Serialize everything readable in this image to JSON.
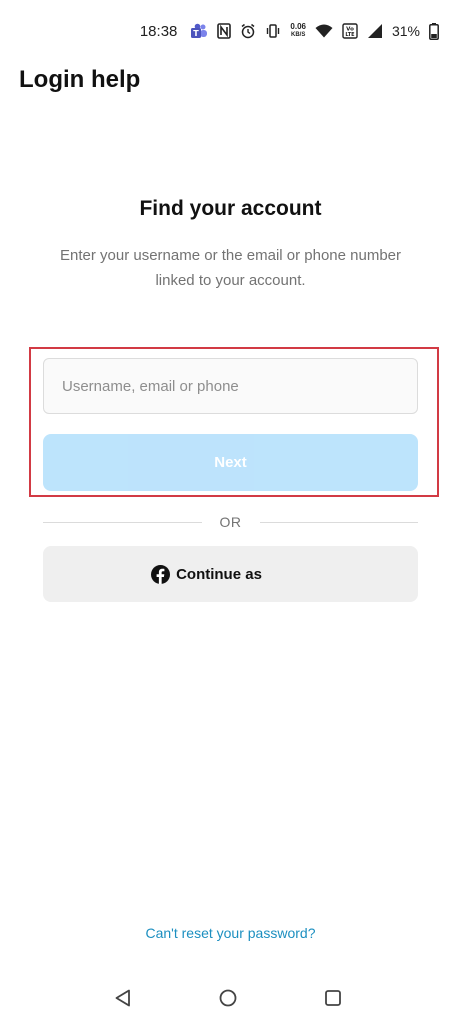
{
  "status_bar": {
    "time": "18:38",
    "net_speed_value": "0.06",
    "net_speed_unit": "KB/S",
    "battery_percent": "31%",
    "icons": [
      "teams-icon",
      "nfc-icon",
      "alarm-icon",
      "vibrate-icon",
      "net-speed-icon",
      "wifi-icon",
      "volte-icon",
      "signal-icon",
      "battery-icon"
    ]
  },
  "header": {
    "title": "Login help"
  },
  "main": {
    "heading": "Find your account",
    "description": "Enter your username or the email or phone number linked to your account.",
    "input": {
      "placeholder": "Username, email or phone",
      "value": ""
    },
    "next_label": "Next",
    "divider_label": "OR",
    "facebook_button_label": "Continue as",
    "reset_link_label": "Can't reset your password?"
  },
  "colors": {
    "accent": "#b2dffc",
    "link": "#1c8fc0",
    "highlight": "#d23a44"
  },
  "nav_bar": {
    "icons": [
      "back-icon",
      "home-icon",
      "recents-icon"
    ]
  }
}
